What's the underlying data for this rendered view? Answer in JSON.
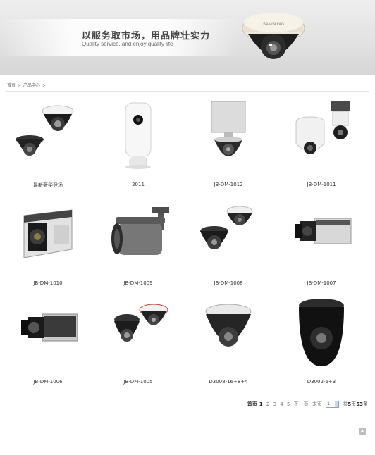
{
  "banner": {
    "slogan_cn": "以服务取市场，用品牌壮实力",
    "slogan_en": "Quality service, and enjoy quality life",
    "camera_brand": "SAMSUNG"
  },
  "breadcrumb": {
    "home": "首页",
    "sep": ">",
    "current": "产品中心"
  },
  "products": [
    {
      "label": "最新奢华登场",
      "icon": "dual-dome-camera-icon"
    },
    {
      "label": "2011",
      "icon": "white-home-camera-icon"
    },
    {
      "label": "JB-DM-1012",
      "icon": "housing-dome-camera-icon"
    },
    {
      "label": "JB-DM-1011",
      "icon": "white-ptz-camera-icon"
    },
    {
      "label": "JB-DM-1010",
      "icon": "box-camera-icon"
    },
    {
      "label": "JB-DM-1009",
      "icon": "bullet-camera-icon"
    },
    {
      "label": "JB-DM-1008",
      "icon": "dual-dome-camera-icon"
    },
    {
      "label": "JB-DM-1007",
      "icon": "box-camera-icon"
    },
    {
      "label": "JB-DM-1006",
      "icon": "box-camera-icon"
    },
    {
      "label": "JB-DM-1005",
      "icon": "dual-dome-camera-icon"
    },
    {
      "label": "D3008-16+8+4",
      "icon": "dome-camera-icon"
    },
    {
      "label": "D3002-6+3",
      "icon": "dome-camera-icon"
    }
  ],
  "pager": {
    "home": "首页",
    "pages": [
      "1",
      "2",
      "3",
      "4",
      "5"
    ],
    "current": "1",
    "next": "下一页",
    "last": "末页",
    "select_value": "1",
    "total_prefix": "共",
    "total_pages": "5",
    "pages_suffix": "页",
    "total_items": "53",
    "items_suffix": "条"
  }
}
